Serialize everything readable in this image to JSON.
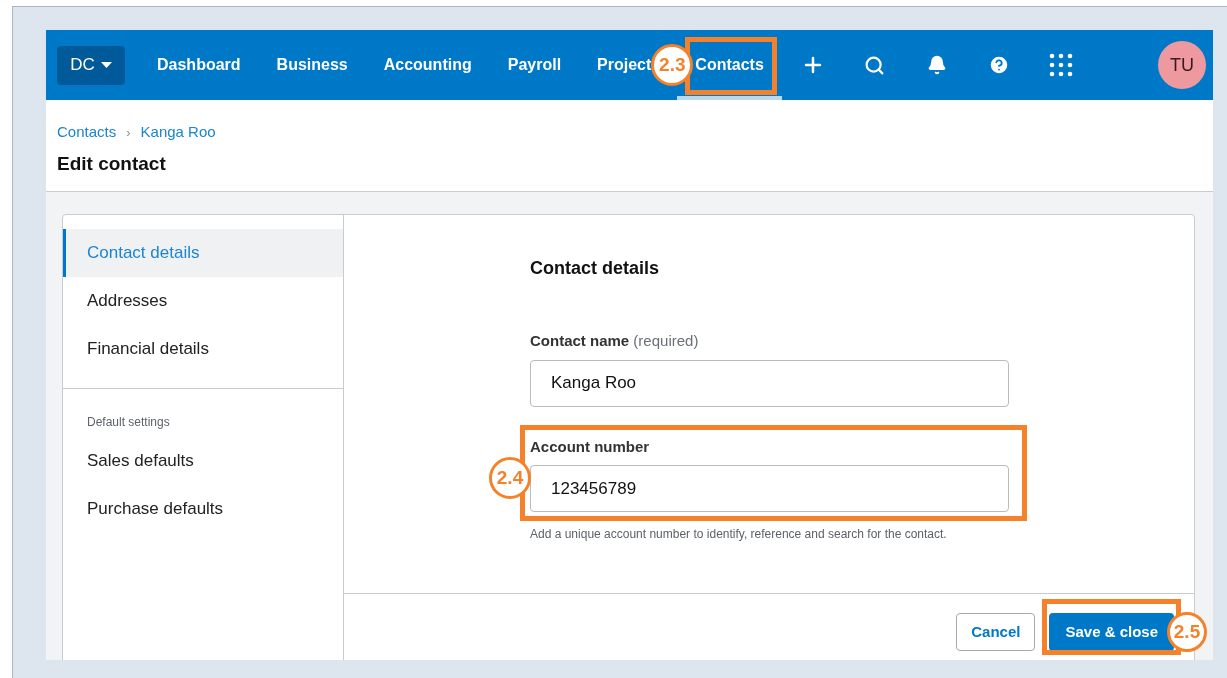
{
  "nav": {
    "org": "DC",
    "items": [
      {
        "label": "Dashboard",
        "selected": false
      },
      {
        "label": "Business",
        "selected": false
      },
      {
        "label": "Accounting",
        "selected": false
      },
      {
        "label": "Payroll",
        "selected": false
      },
      {
        "label": "Project",
        "selected": false
      },
      {
        "label": "Contacts",
        "selected": true,
        "callout": "2.3"
      }
    ],
    "avatar": "TU"
  },
  "breadcrumb": {
    "items": [
      "Contacts",
      "Kanga Roo"
    ],
    "separator": "›"
  },
  "title": "Edit contact",
  "sidebar": {
    "groups": [
      {
        "items": [
          {
            "label": "Contact details",
            "selected": true
          },
          {
            "label": "Addresses",
            "selected": false
          },
          {
            "label": "Financial details",
            "selected": false
          }
        ]
      },
      {
        "heading": "Default settings",
        "items": [
          {
            "label": "Sales defaults",
            "selected": false
          },
          {
            "label": "Purchase defaults",
            "selected": false
          }
        ]
      }
    ]
  },
  "form": {
    "heading": "Contact details",
    "fields": [
      {
        "label": "Contact name",
        "note": "(required)",
        "value": "Kanga Roo"
      },
      {
        "label": "Account number",
        "value": "123456789",
        "hint": "Add a unique account number to identify, reference and search for the contact.",
        "callout": "2.4"
      }
    ]
  },
  "buttons": [
    {
      "label": "Cancel",
      "kind": "secondary"
    },
    {
      "label": "Save & close",
      "kind": "primary",
      "callout": "2.5"
    }
  ]
}
